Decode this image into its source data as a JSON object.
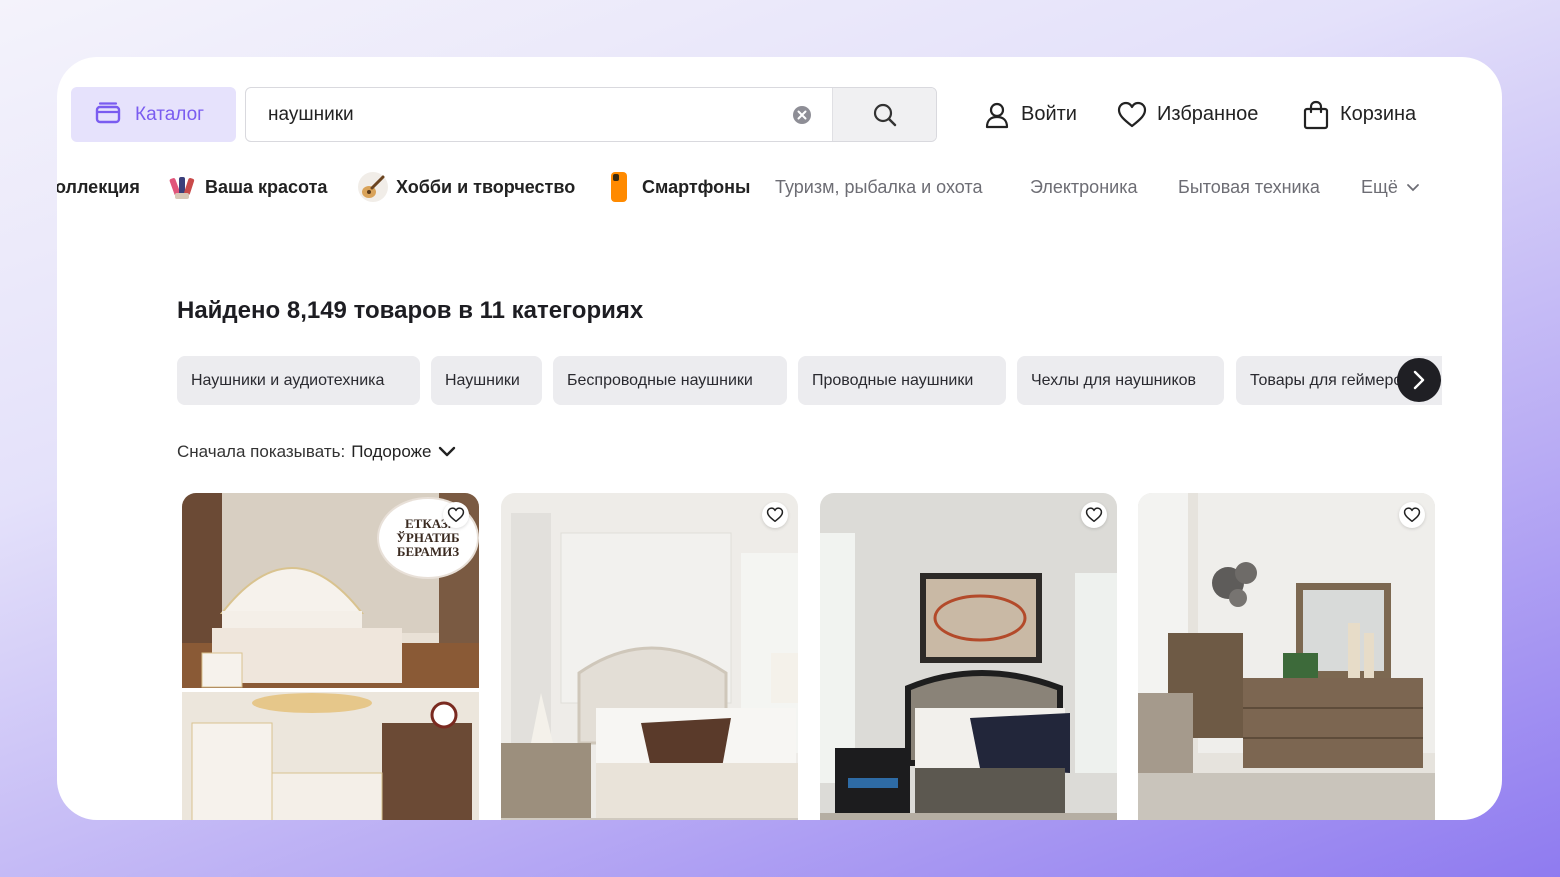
{
  "header": {
    "catalog_label": "Каталог",
    "search_value": "наушники",
    "login_label": "Войти",
    "favorites_label": "Избранное",
    "cart_label": "Корзина"
  },
  "nav": {
    "items": [
      {
        "label": "оллекция"
      },
      {
        "label": "Ваша красота",
        "icon": "cosmetics-icon"
      },
      {
        "label": "Хобби и творчество",
        "icon": "guitar-icon"
      },
      {
        "label": "Смартфоны",
        "icon": "smartphone-icon"
      },
      {
        "label": "Туризм, рыбалка и охота"
      },
      {
        "label": "Электроника"
      },
      {
        "label": "Бытовая техника"
      }
    ],
    "more_label": "Ещё"
  },
  "results": {
    "title": "Найдено 8,149 товаров в 11 категориях",
    "chips": [
      "Наушники и аудиотехника",
      "Наушники",
      "Беспроводные наушники",
      "Проводные наушники",
      "Чехлы для наушников",
      "Товары для геймеров"
    ],
    "sort_label": "Сначала показывать:",
    "sort_value": "Подороже"
  },
  "products": [
    {
      "badge": [
        "ЕТКАЗ.",
        "ЎРНАТИБ",
        "БЕРАМИЗ"
      ]
    },
    {},
    {},
    {}
  ],
  "colors": {
    "accent": "#7a5cf0",
    "accent_bg": "#e6e2fc",
    "chip_bg": "#ececef"
  }
}
